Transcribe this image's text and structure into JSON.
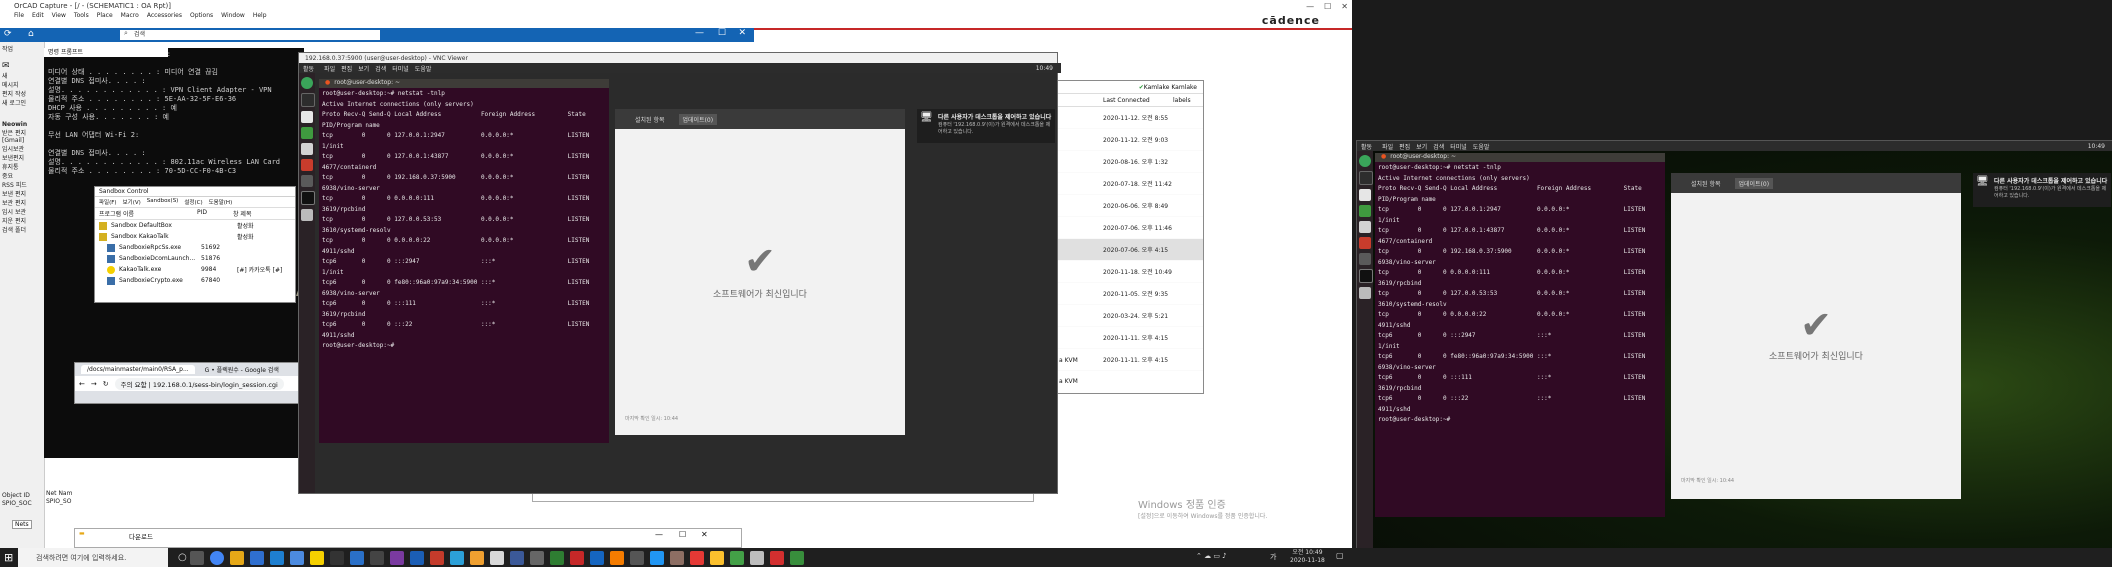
{
  "cadence": {
    "title": "OrCAD Capture - [/ - (SCHEMATIC1 : OA Rpt)]",
    "logo": "cādence",
    "menu": [
      "File",
      "Edit",
      "View",
      "Tools",
      "Place",
      "Macro",
      "Accessories",
      "Options",
      "Window",
      "Help"
    ]
  },
  "search_bar": {
    "placeholder": "검색"
  },
  "cmd": {
    "title": "명령 프롬프트",
    "lines": [
      "    수 없는 어댑터 VPN - VPN Client:",
      "",
      "   미디어 상태 . . . . . . . . : 미디어 연결 끊김",
      "   연결별 DNS 접미사. . . . :",
      "   설명. . . . . . . . . . . . : VPN Client Adapter - VPN",
      "   물리적 주소 . . . . . . . . : 5E-AA-32-5F-E6-36",
      "   DHCP 사용 . . . . . . . . . : 예",
      "   자동 구성 사용. . . . . . . : 예",
      "",
      "무선 LAN 어댑터 Wi-Fi 2:",
      "",
      "   연결별 DNS 접미사. . . . :",
      "   설명. . . . . . . . . . . . : 802.11ac Wireless LAN Card",
      "   물리적 주소 . . . . . . . . : 70-5D-CC-F0-4B-C3"
    ]
  },
  "sidebar": {
    "items": [
      "작업",
      "새",
      "메시지",
      "편지 작성",
      "새 로그인",
      "Neowin",
      "받은 편지",
      "[Gmail]",
      "임시보관",
      "보낸편지",
      "휴지통",
      "중요",
      "RSS 피드",
      "보낸 편지",
      "보관 편지",
      "임시 보관",
      "지운 편지",
      "검색 폴더"
    ]
  },
  "sandbox": {
    "title": "Sandbox Control",
    "menu": [
      "파일(F)",
      "보기(V)",
      "Sandbox(S)",
      "설정(C)",
      "도움말(H)"
    ],
    "headers": [
      "프로그램 이름",
      "PID",
      "창 제목"
    ],
    "rows": [
      {
        "name": "Sandbox DefaultBox",
        "pid": "",
        "title": "활성화"
      },
      {
        "name": "Sandbox KakaoTalk",
        "pid": "",
        "title": "활성화"
      },
      {
        "name": "SandboxieRpcSs.exe",
        "pid": "51692",
        "title": ""
      },
      {
        "name": "SandboxieDcomLaunch...",
        "pid": "51876",
        "title": ""
      },
      {
        "name": "KakaoTalk.exe",
        "pid": "9984",
        "title": "[#] 카카오톡 [#]"
      },
      {
        "name": "SandboxieCrypto.exe",
        "pid": "67840",
        "title": ""
      }
    ]
  },
  "chrome": {
    "tab1": "/docs/mainmaster/main0/RSA_p...",
    "tab2": "G • 플렉원수 - Google 검색",
    "url": "주의 요함 | 192.168.0.1/sess-bin/login_session.cgi"
  },
  "vnc": {
    "title": "192.168.0.37:5900 (user@user-desktop) - VNC Viewer",
    "topbar_left": "활동",
    "menu": [
      "파일",
      "편집",
      "보기",
      "검색",
      "터미널",
      "도움말"
    ],
    "topbar_right": "10:49",
    "term_title": "root@user-desktop: ~",
    "terminal": "root@user-desktop:~# netstat -tnlp\nActive Internet connections (only servers)\nProto Recv-Q Send-Q Local Address           Foreign Address         State\nPID/Program name\ntcp        0      0 127.0.0.1:2947          0.0.0.0:*               LISTEN\n1/init\ntcp        0      0 127.0.0.1:43877         0.0.0.0:*               LISTEN\n4677/containerd\ntcp        0      0 192.168.0.37:5900       0.0.0.0:*               LISTEN\n6938/vino-server\ntcp        0      0 0.0.0.0:111             0.0.0.0:*               LISTEN\n3619/rpcbind\ntcp        0      0 127.0.0.53:53           0.0.0.0:*               LISTEN\n3610/systemd-resolv\ntcp        0      0 0.0.0.0:22              0.0.0.0:*               LISTEN\n4911/sshd\ntcp6       0      0 :::2947                 :::*                    LISTEN\n1/init\ntcp6       0      0 fe80::96a0:97a9:34:5900 :::*                    LISTEN\n6938/vino-server\ntcp6       0      0 :::111                  :::*                    LISTEN\n3619/rpcbind\ntcp6       0      0 :::22                   :::*                    LISTEN\n4911/sshd\nroot@user-desktop:~# ",
    "update_tabs": [
      "업데이트",
      "설치된 항목",
      "업데이트(0)"
    ],
    "update_msg": "소프트웨어가 최신입니다",
    "last_checked": "마지막 확인 일시: 10:44",
    "notify_title": "다른 사용자가 데스크톱을 제어하고 있습니다",
    "notify_body": "컴퓨터 '192.168.0.9'(이)가 원격에서 데스크톱을 제어하고 있습니다."
  },
  "list_window": {
    "user": "Kamlake Kamlake",
    "col_last": "Last Connected",
    "col_labels": "labels",
    "rows": [
      "2020-11-12. 오전 8:55",
      "2020-11-12. 오전 9:03",
      "2020-08-16. 오후 1:32",
      "2020-07-18. 오전 11:42",
      "2020-06-06. 오후 8:49",
      "2020-07-06. 오후 11:46",
      "2020-07-06. 오후 4:15",
      "2020-11-18. 오전 10:49",
      "2020-11-05. 오전 9:35",
      "2020-03-24. 오후 5:21",
      "2020-11-11. 오후 4:15",
      "2020-11-11. 오후 4:15"
    ],
    "side_labels": [
      "a KVM",
      "a KVM"
    ]
  },
  "windows_activate": {
    "line1": "Windows 정품 인증",
    "line2": "[설정]으로 이동하여 Windows를 정품 인증합니다."
  },
  "bottom_left": {
    "object_id": "Object ID",
    "net_name": "Net Nam",
    "val1": "SPIO_SOC",
    "val2": "SPIO_SO",
    "tab": "Nets"
  },
  "explorer_mini": {
    "title": "다운로드"
  },
  "taskbar": {
    "search_placeholder": "검색하려면 여기에 입력하세요.",
    "time": "오전 10:49",
    "date": "2020-11-18",
    "lang": "가"
  },
  "colors": {
    "terminal_bg": "#300a24",
    "taskbar_bg": "#1f1f1f",
    "accent_blue": "#1464b4",
    "cadence_red": "#c62828"
  }
}
